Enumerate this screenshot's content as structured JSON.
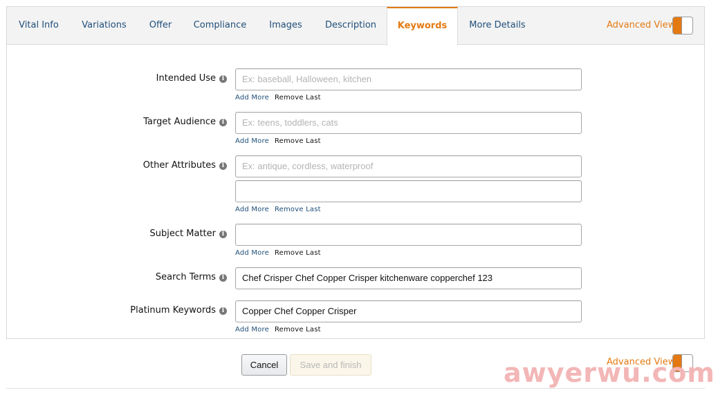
{
  "tabs": [
    {
      "label": "Vital Info"
    },
    {
      "label": "Variations"
    },
    {
      "label": "Offer"
    },
    {
      "label": "Compliance"
    },
    {
      "label": "Images"
    },
    {
      "label": "Description"
    },
    {
      "label": "Keywords",
      "active": true
    },
    {
      "label": "More Details"
    }
  ],
  "advanced_view": {
    "label": "Advanced View",
    "on": true
  },
  "fields": {
    "intended_use": {
      "label": "Intended Use",
      "placeholder": "Ex: baseball, Halloween, kitchen",
      "value": ""
    },
    "target_audience": {
      "label": "Target Audience",
      "placeholder": "Ex: teens, toddlers, cats",
      "value": ""
    },
    "other_attributes": {
      "label": "Other Attributes",
      "placeholder": "Ex: antique, cordless, waterproof",
      "value": "",
      "value2": ""
    },
    "subject_matter": {
      "label": "Subject Matter",
      "value": ""
    },
    "search_terms": {
      "label": "Search Terms",
      "value": "Chef Crisper Chef Copper Crisper kitchenware copperchef 123"
    },
    "platinum_keywords": {
      "label": "Platinum Keywords",
      "value": "Copper Chef Copper Crisper"
    }
  },
  "links": {
    "add_more": "Add More",
    "remove_last": "Remove Last"
  },
  "info_glyph": "i",
  "buttons": {
    "cancel": "Cancel",
    "save_and_finish": "Save and finish"
  },
  "watermark": "awyerwu.com",
  "colors": {
    "accent": "#e47911",
    "link": "#1f4e79"
  }
}
